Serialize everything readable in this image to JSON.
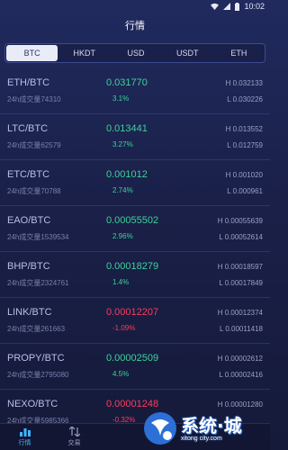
{
  "status_bar": {
    "time": "10:02"
  },
  "title": "行情",
  "tabs": [
    {
      "label": "BTC",
      "active": true
    },
    {
      "label": "HKDT",
      "active": false
    },
    {
      "label": "USD",
      "active": false
    },
    {
      "label": "USDT",
      "active": false
    },
    {
      "label": "ETH",
      "active": false
    }
  ],
  "rows": [
    {
      "pair": "ETH/BTC",
      "volume": "24h成交量74310",
      "price": "0.031770",
      "change": "3.1%",
      "trend": "up",
      "high": "H 0.032133",
      "low": "L 0.030226"
    },
    {
      "pair": "LTC/BTC",
      "volume": "24h成交量62579",
      "price": "0.013441",
      "change": "3.27%",
      "trend": "up",
      "high": "H 0.013552",
      "low": "L 0.012759"
    },
    {
      "pair": "ETC/BTC",
      "volume": "24h成交量70788",
      "price": "0.001012",
      "change": "2.74%",
      "trend": "up",
      "high": "H 0.001020",
      "low": "L 0.000961"
    },
    {
      "pair": "EAO/BTC",
      "volume": "24h成交量1539534",
      "price": "0.00055502",
      "change": "2.96%",
      "trend": "up",
      "high": "H 0.00055639",
      "low": "L 0.00052614"
    },
    {
      "pair": "BHP/BTC",
      "volume": "24h成交量2324761",
      "price": "0.00018279",
      "change": "1.4%",
      "trend": "up",
      "high": "H 0.00018597",
      "low": "L 0.00017849"
    },
    {
      "pair": "LINK/BTC",
      "volume": "24h成交量261663",
      "price": "0.00012207",
      "change": "-1.09%",
      "trend": "down",
      "high": "H 0.00012374",
      "low": "L 0.00011418"
    },
    {
      "pair": "PROPY/BTC",
      "volume": "24h成交量2795080",
      "price": "0.00002509",
      "change": "4.5%",
      "trend": "up",
      "high": "H 0.00002612",
      "low": "L 0.00002416"
    },
    {
      "pair": "NEXO/BTC",
      "volume": "24h成交量5985366",
      "price": "0.00001248",
      "change": "-0.32%",
      "trend": "down",
      "high": "H 0.00001280",
      "low": ""
    }
  ],
  "bottom_nav": [
    {
      "label": "行情",
      "icon": "chart-bars-icon",
      "active": true
    },
    {
      "label": "交易",
      "icon": "trade-arrows-icon",
      "active": false
    }
  ],
  "watermark": {
    "text": "系统·城",
    "sub": "xitong city.com"
  },
  "colors": {
    "up": "#3ed29a",
    "down": "#ff3a5c",
    "accent": "#3fb6ff",
    "background": "#1a2048"
  }
}
